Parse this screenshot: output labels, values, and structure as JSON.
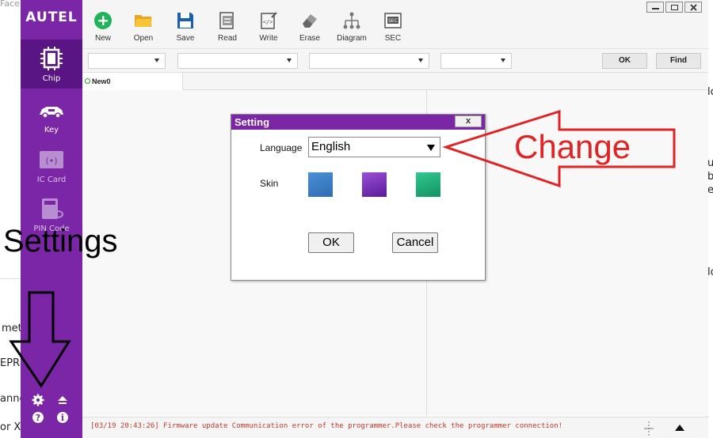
{
  "background_fragments": {
    "top_left": "Facebook",
    "left1": "met",
    "left2": "EPRE",
    "left3": "anne",
    "left4": "or X",
    "right1": "lo",
    "right2": "ul",
    "right3": "b",
    "right4": "e",
    "right5": "lo"
  },
  "app": {
    "logo": "AUTEL",
    "sidebar": [
      {
        "label": "Chip",
        "icon": "chip-icon"
      },
      {
        "label": "Key",
        "icon": "car-key-icon"
      },
      {
        "label": "IC Card",
        "icon": "ic-card-icon"
      },
      {
        "label": "PIN Code",
        "icon": "pin-code-icon"
      }
    ],
    "toolbar": [
      {
        "label": "New",
        "icon": "plus-circle-icon"
      },
      {
        "label": "Open",
        "icon": "folder-icon"
      },
      {
        "label": "Save",
        "icon": "floppy-disk-icon"
      },
      {
        "label": "Read",
        "icon": "read-chip-icon"
      },
      {
        "label": "Write",
        "icon": "write-chip-icon"
      },
      {
        "label": "Erase",
        "icon": "eraser-icon"
      },
      {
        "label": "Diagram",
        "icon": "diagram-icon"
      },
      {
        "label": "SEC",
        "icon": "sec-icon"
      }
    ],
    "filters": {
      "ok_label": "OK",
      "find_label": "Find"
    },
    "tab": {
      "label": "New0"
    },
    "status": {
      "message": "[03/19 20:43:26] Firmware update Communication error of the programmer.Please check the programmer connection!"
    }
  },
  "dialog": {
    "title": "Setting",
    "close_label": "x",
    "language_label": "Language",
    "language_value": "English",
    "skin_label": "Skin",
    "skins": [
      "#3a7fc6",
      "#7b2fbf",
      "#1fb07a"
    ],
    "ok_label": "OK",
    "cancel_label": "Cancel"
  },
  "annotations": {
    "settings_text": "Settings",
    "change_text": "Change",
    "change_color": "#e02424"
  }
}
